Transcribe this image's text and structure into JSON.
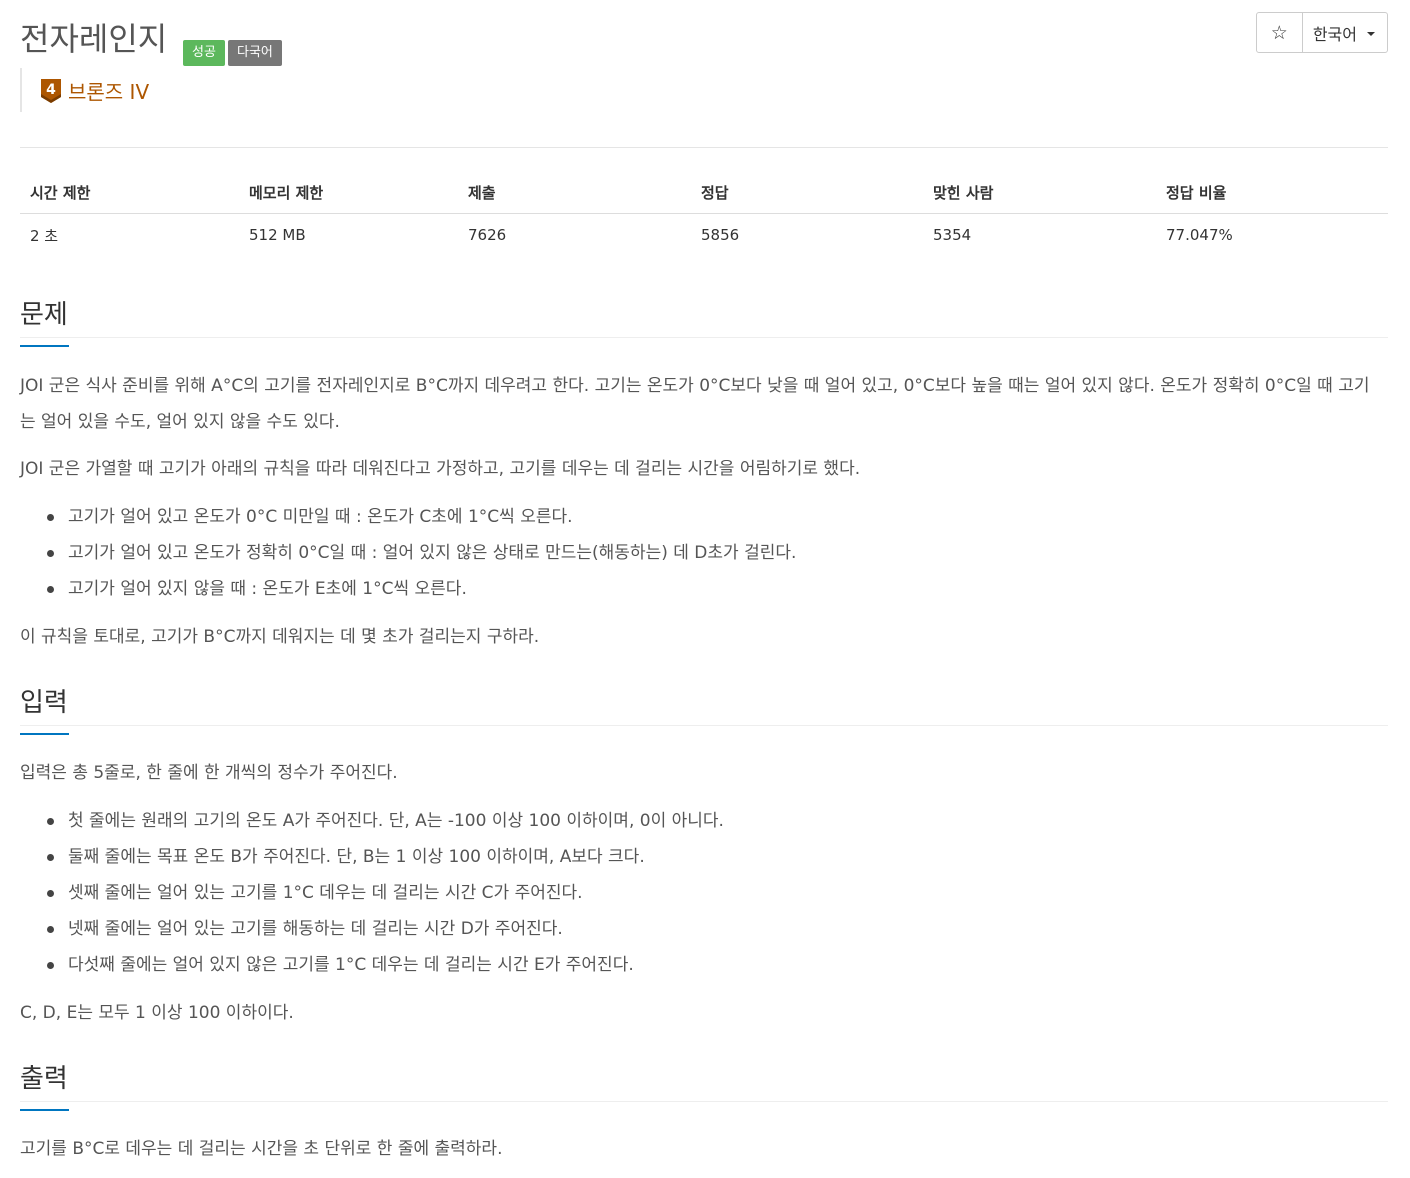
{
  "header": {
    "title": "전자레인지",
    "badges": {
      "success": "성공",
      "multilang": "다국어"
    },
    "star_icon": "☆",
    "language": "한국어"
  },
  "tier": {
    "level": "4",
    "label": "브론즈 IV",
    "color": "#ad5600"
  },
  "info_table": {
    "headers": [
      "시간 제한",
      "메모리 제한",
      "제출",
      "정답",
      "맞힌 사람",
      "정답 비율"
    ],
    "values": [
      "2 초",
      "512 MB",
      "7626",
      "5856",
      "5354",
      "77.047%"
    ]
  },
  "problem": {
    "title": "문제",
    "p1": "JOI 군은 식사 준비를 위해 A°C의 고기를 전자레인지로 B°C까지 데우려고 한다. 고기는 온도가 0°C보다 낮을 때 얼어 있고, 0°C보다 높을 때는 얼어 있지 않다. 온도가 정확히 0°C일 때 고기는 얼어 있을 수도, 얼어 있지 않을 수도 있다.",
    "p2": "JOI 군은 가열할 때 고기가 아래의 규칙을 따라 데워진다고 가정하고, 고기를 데우는 데 걸리는 시간을 어림하기로 했다.",
    "rules": [
      "고기가 얼어 있고 온도가 0°C 미만일 때 : 온도가 C초에 1°C씩 오른다.",
      "고기가 얼어 있고 온도가 정확히 0°C일 때 : 얼어 있지 않은 상태로 만드는(해동하는) 데 D초가 걸린다.",
      "고기가 얼어 있지 않을 때 : 온도가 E초에 1°C씩 오른다."
    ],
    "p3": "이 규칙을 토대로, 고기가 B°C까지 데워지는 데 몇 초가 걸리는지 구하라."
  },
  "input": {
    "title": "입력",
    "p1": "입력은 총 5줄로, 한 줄에 한 개씩의 정수가 주어진다.",
    "items": [
      "첫 줄에는 원래의 고기의 온도 A가 주어진다. 단, A는 -100 이상 100 이하이며, 0이 아니다.",
      "둘째 줄에는 목표 온도 B가 주어진다. 단, B는 1 이상 100 이하이며, A보다 크다.",
      "셋째 줄에는 얼어 있는 고기를 1°C 데우는 데 걸리는 시간 C가 주어진다.",
      "넷째 줄에는 얼어 있는 고기를 해동하는 데 걸리는 시간 D가 주어진다.",
      "다섯째 줄에는 얼어 있지 않은 고기를 1°C 데우는 데 걸리는 시간 E가 주어진다."
    ],
    "p2": "C, D, E는 모두 1 이상 100 이하이다."
  },
  "output": {
    "title": "출력",
    "p1": "고기를 B°C로 데우는 데 걸리는 시간을 초 단위로 한 줄에 출력하라."
  }
}
